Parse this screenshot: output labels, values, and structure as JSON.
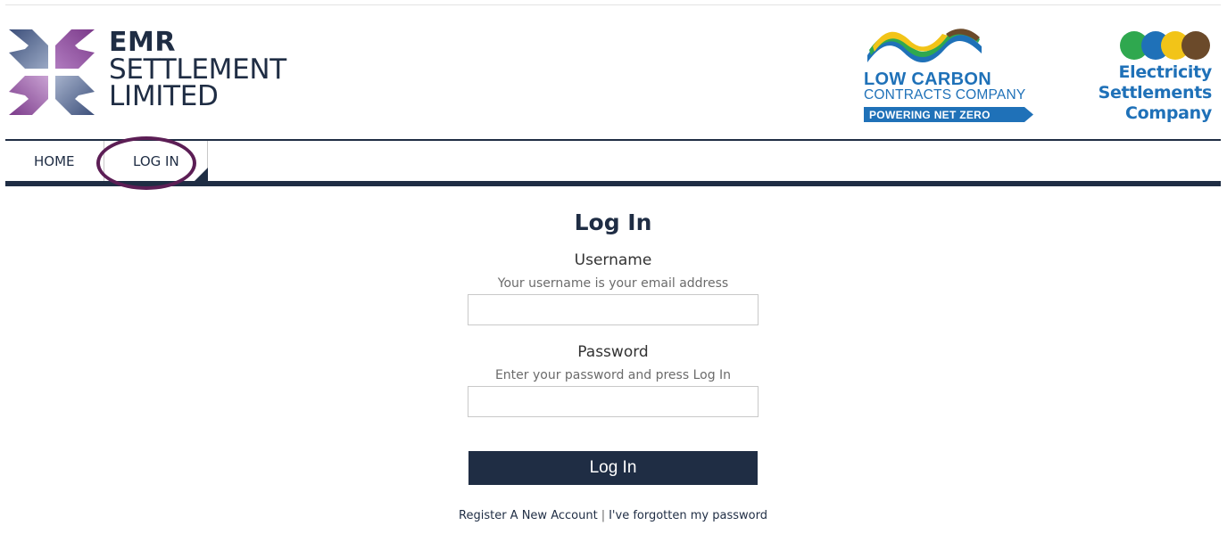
{
  "header": {
    "emr_logo": {
      "line1": "EMR",
      "line2": "SETTLEMENT",
      "line3": "LIMITED"
    },
    "lccc_logo": {
      "name_line1": "LOW CARBON",
      "name_line2": "CONTRACTS COMPANY",
      "tagline": "POWERING NET ZERO"
    },
    "esc_logo": {
      "line1": "Electricity",
      "line2": "Settlements",
      "line3": "Company"
    }
  },
  "nav": {
    "items": [
      {
        "label": "HOME",
        "active": false
      },
      {
        "label": "LOG IN",
        "active": true
      }
    ]
  },
  "login_form": {
    "title": "Log In",
    "username": {
      "label": "Username",
      "hint": "Your username is your email address",
      "value": "",
      "placeholder": ""
    },
    "password": {
      "label": "Password",
      "hint": "Enter your password and press Log In",
      "value": "",
      "placeholder": ""
    },
    "submit_label": "Log In"
  },
  "footer_links": {
    "register": "Register A New Account",
    "separator": "|",
    "forgot": "I've forgotten my password"
  },
  "colors": {
    "navy": "#1f2d44",
    "highlight_ring": "#5c1e55",
    "lccc_blue": "#1f71b8",
    "esc_blue": "#1f71b8",
    "emr_purple": "#7b3a8a",
    "emr_slate": "#5b6a8a"
  },
  "icons": {
    "emr_mark": "emr-four-arrows-logo-icon",
    "lccc_mark": "lccc-waves-logo-icon",
    "esc_mark": "esc-four-circles-logo-icon"
  }
}
